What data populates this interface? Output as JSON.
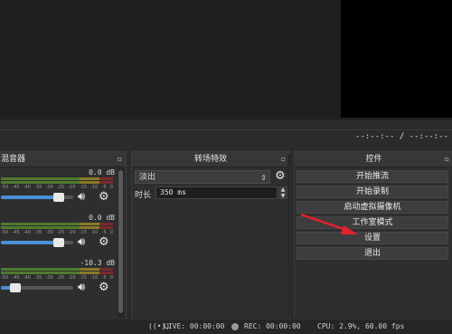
{
  "timecode": "--:--:-- / --:--:--",
  "mixer": {
    "title": "混音器",
    "pop_icon": "▫",
    "tick_labels": [
      "-50",
      "-45",
      "-40",
      "-35",
      "-30",
      "-25",
      "-20",
      "-15",
      "-10",
      "-5",
      "0"
    ],
    "channels": [
      {
        "db": "0.0 dB",
        "volume_fraction": 0.8
      },
      {
        "db": "0.0 dB",
        "volume_fraction": 0.8
      },
      {
        "db": "-10.3 dB",
        "volume_fraction": 0.2
      }
    ]
  },
  "transitions": {
    "title": "转场特效",
    "selected": "淡出",
    "duration_label": "时长",
    "duration_value": "350 ms"
  },
  "controls": {
    "title": "控件",
    "buttons": [
      "开始推流",
      "开始录制",
      "启动虚拟摄像机",
      "工作室模式",
      "设置",
      "退出"
    ]
  },
  "status": {
    "live": "LIVE: 00:00:00",
    "rec": "REC: 00:00:00",
    "cpu": "CPU: 2.9%, 60.00 fps"
  },
  "colors": {
    "accent_blue": "#4a90d9",
    "annotation_arrow": "#e8202a"
  }
}
